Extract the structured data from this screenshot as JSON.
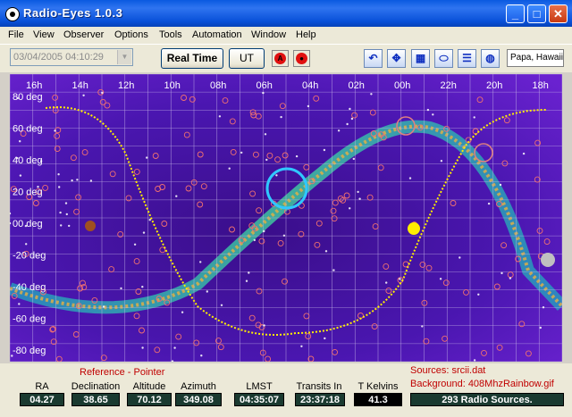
{
  "window": {
    "title": "Radio-Eyes    1.0.3",
    "min": "_",
    "max": "□",
    "close": "✕"
  },
  "menu": [
    "File",
    "View",
    "Observer",
    "Options",
    "Tools",
    "Automation",
    "Window",
    "Help"
  ],
  "toolbar": {
    "datetime": "03/04/2005   04:10:29",
    "real_time": "Real Time",
    "ut": "UT",
    "icons": [
      "undo-icon",
      "compass-icon",
      "grid-icon",
      "ellipse-icon",
      "list-icon",
      "globe-icon"
    ],
    "location": "Papa, Hawaii"
  },
  "skymap": {
    "ra_labels": [
      "16h",
      "14h",
      "12h",
      "10h",
      "08h",
      "06h",
      "04h",
      "02h",
      "00h",
      "22h",
      "20h",
      "18h"
    ],
    "dec_labels": [
      "80 deg",
      "60 deg",
      "40 deg",
      "20 deg",
      "00 deg",
      "-20 deg",
      "-40 deg",
      "-60 deg",
      "-80 deg"
    ],
    "background_color": "#5a18b8",
    "ecliptic_color": "#ffee00",
    "grid_color": "#c8b8e8"
  },
  "status": {
    "reference": "Reference - Pointer",
    "sources_file": "Sources: srcii.dat",
    "background_file": "Background: 408MhzRainbow.gif",
    "fields": [
      {
        "label": "RA",
        "value": "04.27"
      },
      {
        "label": "Declination",
        "value": "38.65"
      },
      {
        "label": "Altitude",
        "value": "70.12"
      },
      {
        "label": "Azimuth",
        "value": "349.08"
      },
      {
        "label": "LMST",
        "value": "04:35:07"
      },
      {
        "label": "Transits In",
        "value": "23:37:18"
      },
      {
        "label": "T Kelvins",
        "value": "41.3"
      }
    ],
    "source_count": "293 Radio Sources."
  }
}
